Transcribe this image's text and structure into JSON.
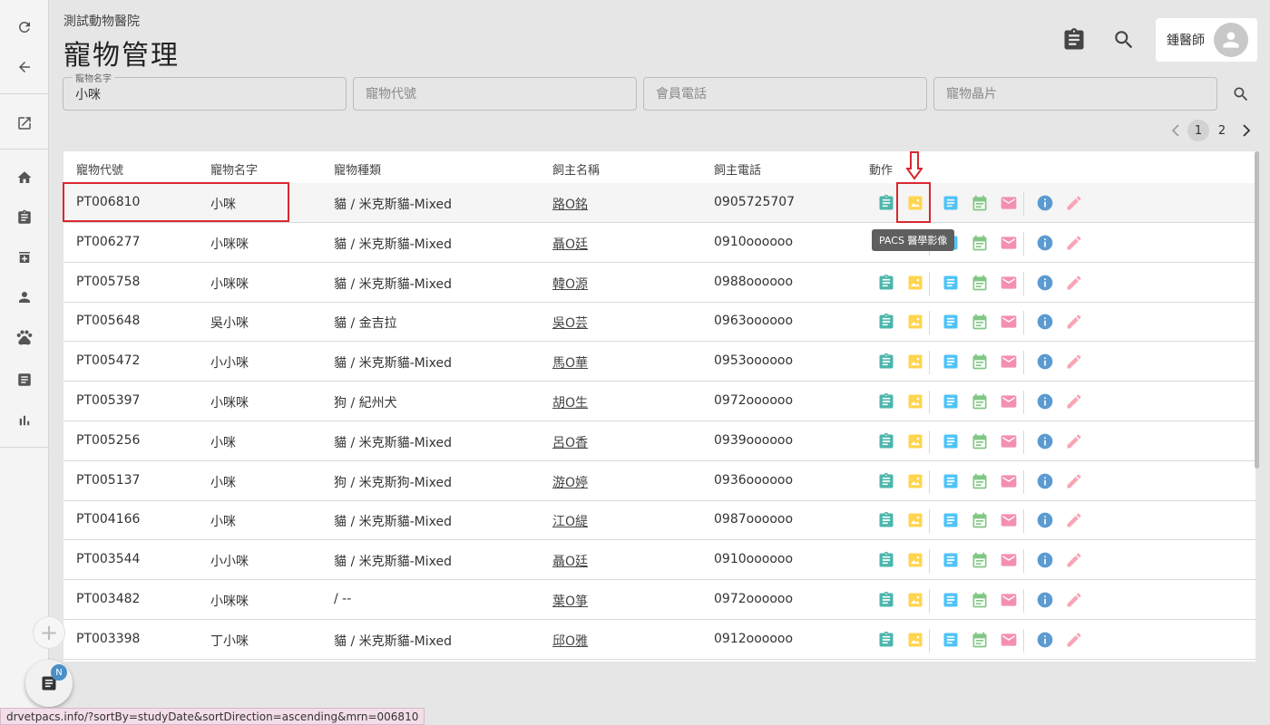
{
  "header": {
    "clinic": "測試動物醫院",
    "title": "寵物管理",
    "user": "鍾醫師"
  },
  "search": {
    "name_label": "寵物名字",
    "name_value": "小咪",
    "code_placeholder": "寵物代號",
    "phone_placeholder": "會員電話",
    "chip_placeholder": "寵物晶片"
  },
  "pagination": {
    "pages": [
      "1",
      "2"
    ],
    "current": "1"
  },
  "table": {
    "headers": [
      "寵物代號",
      "寵物名字",
      "寵物種類",
      "飼主名稱",
      "飼主電話",
      "動作"
    ],
    "rows": [
      {
        "code": "PT006810",
        "name": "小咪",
        "species": "貓 / 米克斯貓-Mixed",
        "owner": "路O銘",
        "phone": "0905725707"
      },
      {
        "code": "PT006277",
        "name": "小咪咪",
        "species": "貓 / 米克斯貓-Mixed",
        "owner": "聶O廷",
        "phone": "0910oooooo"
      },
      {
        "code": "PT005758",
        "name": "小咪咪",
        "species": "貓 / 米克斯貓-Mixed",
        "owner": "韓O源",
        "phone": "0988oooooo"
      },
      {
        "code": "PT005648",
        "name": "吳小咪",
        "species": "貓 / 金吉拉",
        "owner": "吳O芸",
        "phone": "0963oooooo"
      },
      {
        "code": "PT005472",
        "name": "小小咪",
        "species": "貓 / 米克斯貓-Mixed",
        "owner": "馬O華",
        "phone": "0953oooooo"
      },
      {
        "code": "PT005397",
        "name": "小咪咪",
        "species": "狗 / 紀州犬",
        "owner": "胡O生",
        "phone": "0972oooooo"
      },
      {
        "code": "PT005256",
        "name": "小咪",
        "species": "貓 / 米克斯貓-Mixed",
        "owner": "呂O香",
        "phone": "0939oooooo"
      },
      {
        "code": "PT005137",
        "name": "小咪",
        "species": "狗 / 米克斯狗-Mixed",
        "owner": "游O婷",
        "phone": "0936oooooo"
      },
      {
        "code": "PT004166",
        "name": "小咪",
        "species": "貓 / 米克斯貓-Mixed",
        "owner": "江O緹",
        "phone": "0987oooooo"
      },
      {
        "code": "PT003544",
        "name": "小小咪",
        "species": "貓 / 米克斯貓-Mixed",
        "owner": "聶O廷",
        "phone": "0910oooooo"
      },
      {
        "code": "PT003482",
        "name": "小咪咪",
        "species": "/ --",
        "owner": "葉O箏",
        "phone": "0972oooooo"
      },
      {
        "code": "PT003398",
        "name": "丁小咪",
        "species": "貓 / 米克斯貓-Mixed",
        "owner": "邱O雅",
        "phone": "0912oooooo"
      }
    ]
  },
  "action_icons": [
    "clipboard-icon",
    "image-icon",
    "document-icon",
    "calendar-icon",
    "mail-icon",
    "info-icon",
    "edit-icon"
  ],
  "tooltip": "PACS 醫學影像",
  "fab_badge": "N",
  "status_url": "drvetpacs.info/?sortBy=studyDate&sortDirection=ascending&mrn=006810",
  "colors": {
    "clipboard": "#4db6ac",
    "image": "#ffd54f",
    "document": "#4fc3f7",
    "calendar": "#81c784",
    "mail": "#f48fb1",
    "info": "#5c9bd1",
    "edit": "#f8a5b5",
    "highlight": "#d9282f"
  }
}
